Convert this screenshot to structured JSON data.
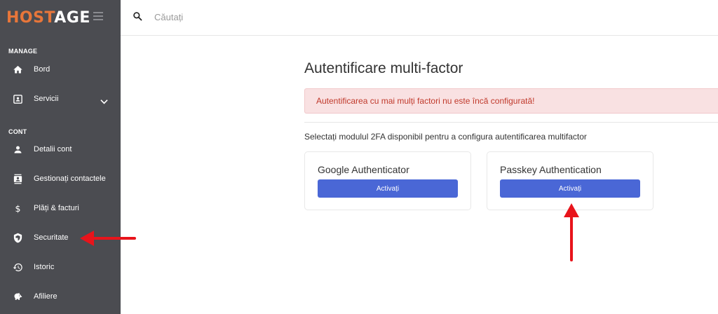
{
  "brand": {
    "part1": "HOST",
    "part2": "AGE"
  },
  "sidebar": {
    "sections": [
      {
        "label": "MANAGE"
      },
      {
        "label": "CONT"
      }
    ],
    "items": [
      {
        "label": "Bord",
        "icon": "home-icon"
      },
      {
        "label": "Servicii",
        "icon": "services-icon",
        "expandable": true
      },
      {
        "label": "Detalii cont",
        "icon": "user-icon"
      },
      {
        "label": "Gestionați contactele",
        "icon": "contacts-icon"
      },
      {
        "label": "Plăți & facturi",
        "icon": "dollar-icon"
      },
      {
        "label": "Securitate",
        "icon": "shield-icon"
      },
      {
        "label": "Istoric",
        "icon": "history-icon"
      },
      {
        "label": "Afiliere",
        "icon": "piggy-bank-icon"
      }
    ]
  },
  "search": {
    "placeholder": "Căutați",
    "value": ""
  },
  "main": {
    "title": "Autentificare multi-factor",
    "alert": "Autentificarea cu mai mulți factori nu este încă configurată!",
    "instruction": "Selectați modulul 2FA disponibil pentru a configura autentificarea multifactor",
    "modules": [
      {
        "name": "Google Authenticator",
        "button": "Activați"
      },
      {
        "name": "Passkey Authentication",
        "button": "Activați"
      }
    ]
  },
  "colors": {
    "sidebar_bg": "#4b4c51",
    "brand_accent": "#e8763a",
    "button": "#4a67d6",
    "alert_bg": "#f9e1e2",
    "alert_text": "#c0392b",
    "annotation_arrow": "#e8141b"
  }
}
